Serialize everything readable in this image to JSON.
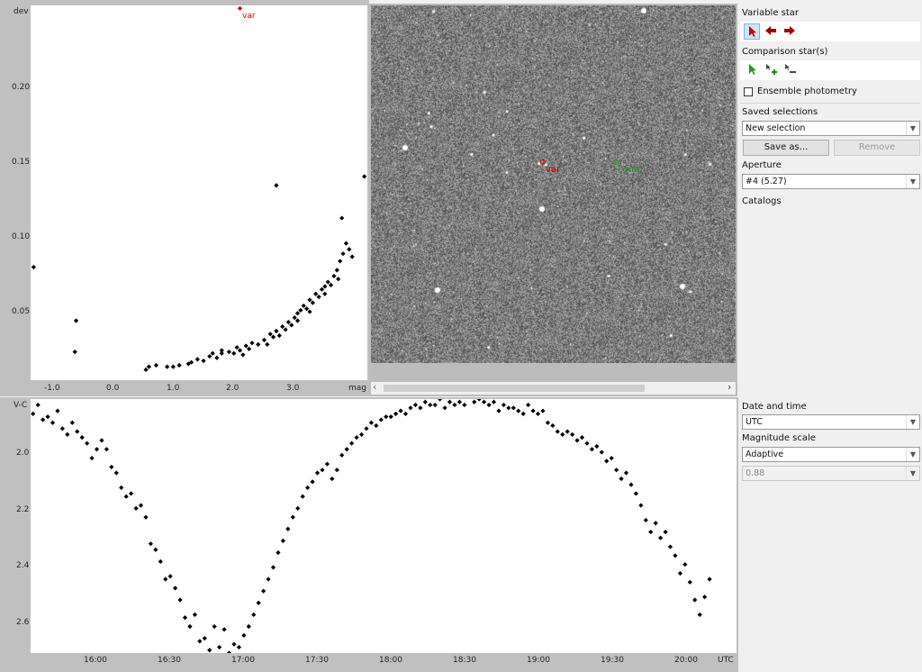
{
  "scatter_plot": {
    "y_axis_title": "dev",
    "x_axis_title": "mag",
    "y_ticks": [
      "0.20",
      "0.15",
      "0.10",
      "0.05"
    ],
    "x_ticks": [
      "-1.0",
      "0.0",
      "1.0",
      "2.0",
      "3.0"
    ],
    "var_label": "var"
  },
  "image_view": {
    "var_label": "var",
    "comp_label": "comp",
    "scroll_left": "‹",
    "scroll_right": "›"
  },
  "light_curve": {
    "y_axis_title": "V-C",
    "x_axis_title": "UTC",
    "y_ticks": [
      "2.0",
      "2.2",
      "2.4",
      "2.6"
    ],
    "x_ticks": [
      "16:00",
      "16:30",
      "17:00",
      "17:30",
      "18:00",
      "18:30",
      "19:00",
      "19:30",
      "20:00"
    ]
  },
  "side_panel": {
    "variable_star_label": "Variable star",
    "comparison_star_label": "Comparison star(s)",
    "ensemble_label": "Ensemble photometry",
    "saved_selections_label": "Saved selections",
    "saved_selection_value": "New selection",
    "save_as_label": "Save as...",
    "remove_label": "Remove",
    "aperture_label": "Aperture",
    "aperture_value": "#4 (5.27)",
    "catalogs_label": "Catalogs"
  },
  "bottom_panel": {
    "date_time_label": "Date and time",
    "date_time_value": "UTC",
    "magnitude_scale_label": "Magnitude scale",
    "magnitude_scale_value": "Adaptive",
    "scale_value": "0.88"
  },
  "colors": {
    "var_marker": "#d40000",
    "comp_marker": "#1a9a1a",
    "data_point": "#000000"
  },
  "chart_data": [
    {
      "type": "scatter",
      "xlabel": "mag",
      "ylabel": "dev",
      "xlim": [
        -1.35,
        4.2
      ],
      "ylim": [
        0.0,
        0.252
      ],
      "points": [
        [
          -1.3,
          0.076
        ],
        [
          -0.6,
          0.04
        ],
        [
          -0.62,
          0.019
        ],
        [
          0.55,
          0.007
        ],
        [
          0.6,
          0.009
        ],
        [
          0.72,
          0.01
        ],
        [
          0.9,
          0.009
        ],
        [
          1.0,
          0.009
        ],
        [
          1.1,
          0.01
        ],
        [
          1.25,
          0.011
        ],
        [
          1.3,
          0.012
        ],
        [
          1.4,
          0.014
        ],
        [
          1.5,
          0.013
        ],
        [
          1.6,
          0.016
        ],
        [
          1.65,
          0.018
        ],
        [
          1.72,
          0.015
        ],
        [
          1.8,
          0.02
        ],
        [
          1.92,
          0.019
        ],
        [
          2.0,
          0.018
        ],
        [
          2.05,
          0.022
        ],
        [
          2.1,
          0.02
        ],
        [
          2.15,
          0.017
        ],
        [
          2.2,
          0.023
        ],
        [
          2.25,
          0.021
        ],
        [
          2.3,
          0.025
        ],
        [
          2.4,
          0.024
        ],
        [
          2.5,
          0.027
        ],
        [
          2.6,
          0.031
        ],
        [
          2.65,
          0.029
        ],
        [
          2.7,
          0.033
        ],
        [
          2.75,
          0.03
        ],
        [
          2.8,
          0.036
        ],
        [
          2.85,
          0.034
        ],
        [
          2.9,
          0.039
        ],
        [
          2.95,
          0.037
        ],
        [
          3.0,
          0.042
        ],
        [
          3.05,
          0.045
        ],
        [
          3.1,
          0.047
        ],
        [
          3.15,
          0.05
        ],
        [
          3.2,
          0.048
        ],
        [
          3.25,
          0.054
        ],
        [
          3.3,
          0.052
        ],
        [
          3.35,
          0.058
        ],
        [
          3.4,
          0.056
        ],
        [
          3.45,
          0.061
        ],
        [
          3.5,
          0.063
        ],
        [
          3.55,
          0.066
        ],
        [
          3.6,
          0.064
        ],
        [
          3.65,
          0.07
        ],
        [
          3.7,
          0.074
        ],
        [
          3.75,
          0.08
        ],
        [
          3.8,
          0.085
        ],
        [
          3.85,
          0.092
        ],
        [
          3.9,
          0.088
        ],
        [
          3.95,
          0.083
        ],
        [
          3.78,
          0.109
        ],
        [
          2.7,
          0.131
        ],
        [
          4.15,
          0.137
        ],
        [
          1.8,
          0.018
        ],
        [
          2.55,
          0.024
        ],
        [
          3.05,
          0.04
        ],
        [
          3.25,
          0.046
        ],
        [
          3.5,
          0.058
        ],
        [
          3.72,
          0.068
        ]
      ],
      "highlight": {
        "label": "var",
        "x": 2.1,
        "y": 0.25
      }
    },
    {
      "type": "scatter",
      "xlabel": "UTC",
      "ylabel": "V-C",
      "xlim": [
        "15:39",
        "20:27"
      ],
      "ylim": [
        2.71,
        1.85
      ],
      "points": [
        [
          "15:40",
          1.9
        ],
        [
          "15:42",
          1.87
        ],
        [
          "15:44",
          1.92
        ],
        [
          "15:46",
          1.91
        ],
        [
          "15:48",
          1.93
        ],
        [
          "15:50",
          1.89
        ],
        [
          "15:52",
          1.95
        ],
        [
          "15:54",
          1.97
        ],
        [
          "15:56",
          1.93
        ],
        [
          "15:58",
          1.96
        ],
        [
          "16:00",
          1.98
        ],
        [
          "16:02",
          2.0
        ],
        [
          "16:04",
          2.05
        ],
        [
          "16:06",
          2.02
        ],
        [
          "16:08",
          1.99
        ],
        [
          "16:10",
          2.02
        ],
        [
          "16:12",
          2.08
        ],
        [
          "16:14",
          2.1
        ],
        [
          "16:16",
          2.15
        ],
        [
          "16:18",
          2.18
        ],
        [
          "16:20",
          2.17
        ],
        [
          "16:22",
          2.22
        ],
        [
          "16:24",
          2.21
        ],
        [
          "16:26",
          2.25
        ],
        [
          "16:28",
          2.34
        ],
        [
          "16:30",
          2.36
        ],
        [
          "16:32",
          2.4
        ],
        [
          "16:34",
          2.46
        ],
        [
          "16:36",
          2.45
        ],
        [
          "16:38",
          2.49
        ],
        [
          "16:40",
          2.53
        ],
        [
          "16:42",
          2.59
        ],
        [
          "16:44",
          2.62
        ],
        [
          "16:46",
          2.58
        ],
        [
          "16:48",
          2.67
        ],
        [
          "16:50",
          2.66
        ],
        [
          "16:52",
          2.7
        ],
        [
          "16:54",
          2.62
        ],
        [
          "16:56",
          2.69
        ],
        [
          "16:58",
          2.63
        ],
        [
          "17:00",
          2.71
        ],
        [
          "17:02",
          2.68
        ],
        [
          "17:04",
          2.69
        ],
        [
          "17:06",
          2.65
        ],
        [
          "17:08",
          2.62
        ],
        [
          "17:10",
          2.58
        ],
        [
          "17:12",
          2.54
        ],
        [
          "17:14",
          2.5
        ],
        [
          "17:16",
          2.46
        ],
        [
          "17:18",
          2.42
        ],
        [
          "17:20",
          2.37
        ],
        [
          "17:22",
          2.33
        ],
        [
          "17:24",
          2.29
        ],
        [
          "17:26",
          2.25
        ],
        [
          "17:28",
          2.22
        ],
        [
          "17:30",
          2.18
        ],
        [
          "17:32",
          2.15
        ],
        [
          "17:34",
          2.13
        ],
        [
          "17:36",
          2.1
        ],
        [
          "17:38",
          2.09
        ],
        [
          "17:40",
          2.07
        ],
        [
          "17:42",
          2.12
        ],
        [
          "17:44",
          2.09
        ],
        [
          "17:46",
          2.04
        ],
        [
          "17:48",
          2.02
        ],
        [
          "17:50",
          2.0
        ],
        [
          "17:52",
          1.98
        ],
        [
          "17:54",
          1.97
        ],
        [
          "17:56",
          1.95
        ],
        [
          "17:58",
          1.93
        ],
        [
          "18:00",
          1.94
        ],
        [
          "18:02",
          1.92
        ],
        [
          "18:04",
          1.91
        ],
        [
          "18:06",
          1.91
        ],
        [
          "18:08",
          1.9
        ],
        [
          "18:10",
          1.89
        ],
        [
          "18:12",
          1.9
        ],
        [
          "18:14",
          1.88
        ],
        [
          "18:16",
          1.87
        ],
        [
          "18:18",
          1.88
        ],
        [
          "18:20",
          1.86
        ],
        [
          "18:22",
          1.87
        ],
        [
          "18:24",
          1.87
        ],
        [
          "18:26",
          1.85
        ],
        [
          "18:28",
          1.88
        ],
        [
          "18:30",
          1.86
        ],
        [
          "18:32",
          1.87
        ],
        [
          "18:34",
          1.86
        ],
        [
          "18:36",
          1.87
        ],
        [
          "18:38",
          1.84
        ],
        [
          "18:40",
          1.86
        ],
        [
          "18:42",
          1.85
        ],
        [
          "18:44",
          1.86
        ],
        [
          "18:46",
          1.87
        ],
        [
          "18:48",
          1.86
        ],
        [
          "18:50",
          1.89
        ],
        [
          "18:52",
          1.87
        ],
        [
          "18:54",
          1.88
        ],
        [
          "18:56",
          1.88
        ],
        [
          "18:58",
          1.89
        ],
        [
          "19:00",
          1.9
        ],
        [
          "19:02",
          1.87
        ],
        [
          "19:04",
          1.89
        ],
        [
          "19:06",
          1.9
        ],
        [
          "19:08",
          1.89
        ],
        [
          "19:10",
          1.93
        ],
        [
          "19:12",
          1.94
        ],
        [
          "19:14",
          1.96
        ],
        [
          "19:16",
          1.97
        ],
        [
          "19:18",
          1.96
        ],
        [
          "19:20",
          1.97
        ],
        [
          "19:22",
          1.99
        ],
        [
          "19:24",
          1.98
        ],
        [
          "19:26",
          2.0
        ],
        [
          "19:28",
          2.02
        ],
        [
          "19:30",
          2.01
        ],
        [
          "19:32",
          2.03
        ],
        [
          "19:34",
          2.06
        ],
        [
          "19:36",
          2.05
        ],
        [
          "19:38",
          2.09
        ],
        [
          "19:40",
          2.12
        ],
        [
          "19:42",
          2.1
        ],
        [
          "19:44",
          2.14
        ],
        [
          "19:46",
          2.17
        ],
        [
          "19:48",
          2.21
        ],
        [
          "19:50",
          2.26
        ],
        [
          "19:52",
          2.3
        ],
        [
          "19:54",
          2.27
        ],
        [
          "19:56",
          2.32
        ],
        [
          "19:58",
          2.3
        ],
        [
          "20:00",
          2.35
        ],
        [
          "20:02",
          2.38
        ],
        [
          "20:04",
          2.44
        ],
        [
          "20:06",
          2.41
        ],
        [
          "20:08",
          2.47
        ],
        [
          "20:10",
          2.53
        ],
        [
          "20:12",
          2.58
        ],
        [
          "20:14",
          2.52
        ],
        [
          "20:16",
          2.46
        ]
      ]
    }
  ]
}
